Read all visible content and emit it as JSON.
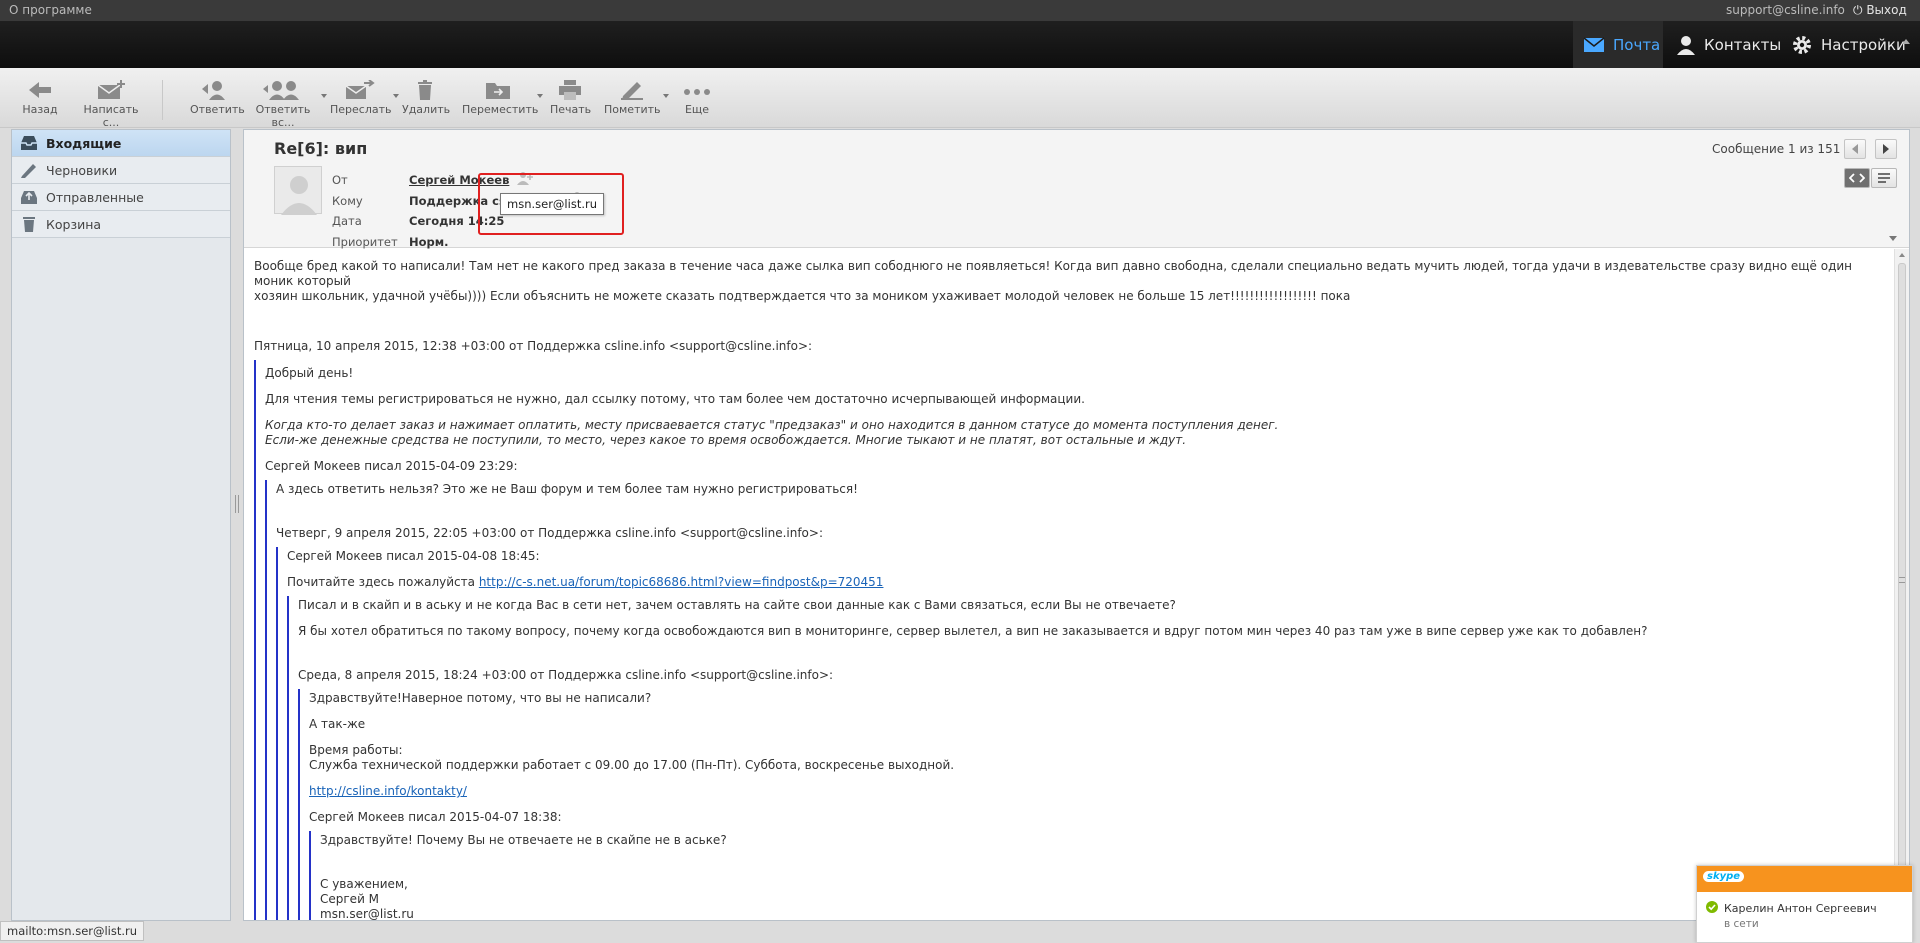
{
  "topbar": {
    "about": "О программе",
    "user_email": "support@csline.info",
    "logout": "Выход"
  },
  "nav": {
    "mail": "Почта",
    "contacts": "Контакты",
    "settings": "Настройки"
  },
  "toolbar": {
    "back": "Назад",
    "compose": "Написать с...",
    "reply": "Ответить",
    "reply_all": "Ответить вс...",
    "forward": "Переслать",
    "delete": "Удалить",
    "move": "Переместить",
    "print": "Печать",
    "mark": "Пометить",
    "more": "Еще"
  },
  "folders": [
    {
      "label": "Входящие",
      "icon": "inbox-icon"
    },
    {
      "label": "Черновики",
      "icon": "pencil-icon"
    },
    {
      "label": "Отправленные",
      "icon": "sent-icon"
    },
    {
      "label": "Корзина",
      "icon": "trash-icon"
    }
  ],
  "message": {
    "subject": "Re[6]: вип",
    "counter": "Сообщение 1 из 151",
    "from_label": "От",
    "from_value": "Сергей Мокеев",
    "to_label": "Кому",
    "to_value": "Поддержка csline.info",
    "date_label": "Дата",
    "date_value": "Сегодня 14:25",
    "priority_label": "Приоритет",
    "priority_value": "Норм.",
    "tooltip": "msn.ser@list.ru",
    "body": {
      "p1": "Вообще бред какой то написали! Там нет не какого пред заказа в течение часа даже сылка вип сободнюго не появляеться! Когда вип давно свободна, сделали специально ведать мучить людей, тогда удачи в издевательстве сразу видно ещё один моник который",
      "p1b": "хозяин школьник, удачной учёбы)))) Если объяснить не можете сказать подтверждается что за моником ухаживает молодой человек не больше 15 лет!!!!!!!!!!!!!!!!!! пока",
      "h1": "Пятница, 10 апреля 2015, 12:38 +03:00 от Поддержка csline.info <support@csline.info>:",
      "q1a": "Добрый день!",
      "q1b": "Для чтения темы регистрироваться не нужно, дал ссылку потому, что там более чем достаточно исчерпывающей информации.",
      "q1c1": "Когда кто-то делает заказ и нажимает оплатить, месту присваевается статус \"предзаказ\" и оно находится в данном статусе до момента поступления денег.",
      "q1c2": "Если-же денежные средства не поступили, то место, через какое то время освобождается. Многие тыкают и не платят, вот остальные и ждут.",
      "q1d": "Сергей Мокеев писал 2015-04-09 23:29:",
      "q2a": "А здесь ответить нельзя? Это же не Ваш форум и тем более там нужно регистрироваться!",
      "h2": "Четверг, 9 апреля 2015, 22:05 +03:00 от Поддержка csline.info <support@csline.info>:",
      "q3a": "Сергей Мокеев писал 2015-04-08 18:45:",
      "q3b": "Почитайте здесь пожалуйста",
      "q3link": "http://c-s.net.ua/forum/topic68686.html?view=findpost&p=720451",
      "q4a": "Писал и в скайп и в аську и не когда Вас в сети нет, зачем оставлять на сайте свои данные как с Вами связаться, если Вы не отвечаете?",
      "q4b": "Я бы хотел обратиться по такому вопросу, почему когда освобождаются вип в мониторинге, сервер вылетел, а вип не заказывается и вдруг потом мин через 40 раз там уже в випе сервер уже как то добавлен?",
      "h3": "Среда, 8 апреля 2015, 18:24 +03:00 от Поддержка csline.info <support@csline.info>:",
      "q5a": "Здравствуйте!Наверное потому, что вы не написали?",
      "q5b": "А так-же",
      "q5c1": "Время работы:",
      "q5c2": "Служба технической поддержки работает с 09.00 до 17.00 (Пн-Пт). Суббота, воскресенье выходной.",
      "q5link": "http://csline.info/kontakty/",
      "q5d": "Сергей Мокеев писал 2015-04-07 18:38:",
      "q6a": "Здравствуйте! Почему Вы не отвечаете не в скайпе не в аське?",
      "q6b1": "С уважением,",
      "q6b2": "Сергей М",
      "q6b3": "msn.ser@list.ru"
    }
  },
  "statusbar": {
    "text": "mailto:msn.ser@list.ru"
  },
  "skype": {
    "brand": "skype",
    "contact": "Карелин Антон Сергеевич",
    "status": "в сети"
  },
  "colors": {
    "accent": "#4aa8ff",
    "quote_bar": "#2432c8",
    "skype": "#f7931e",
    "highlight": "#e02020"
  }
}
